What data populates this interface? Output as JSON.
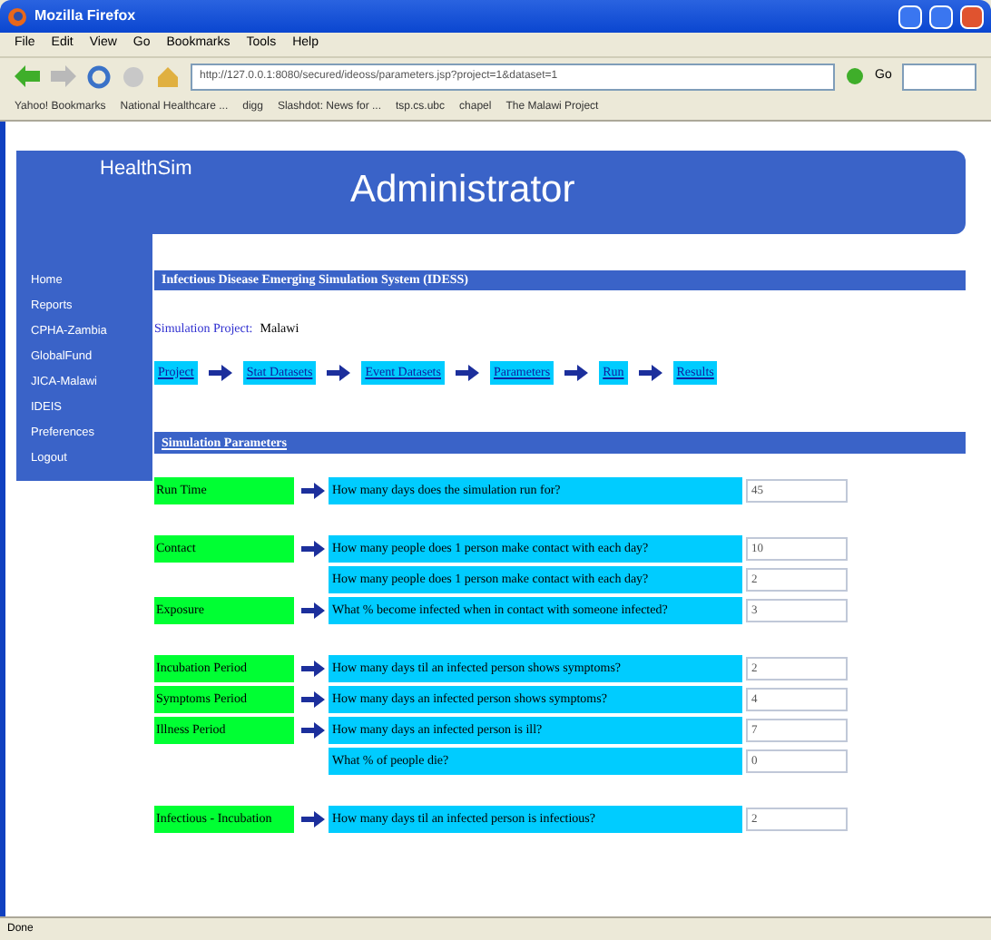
{
  "window": {
    "title": "Mozilla Firefox"
  },
  "menu": [
    "File",
    "Edit",
    "View",
    "Go",
    "Bookmarks",
    "Tools",
    "Help"
  ],
  "address": {
    "value": "http://127.0.0.1:8080/secured/ideoss/parameters.jsp?project=1&dataset=1"
  },
  "go_button": "Go",
  "bookmarks": [
    "Yahoo! Bookmarks",
    "National Healthcare ...",
    "digg",
    "Slashdot: News for ...",
    "tsp.cs.ubc",
    "chapel",
    "The Malawi Project"
  ],
  "header": {
    "logo": "HealthSim",
    "title": "Administrator"
  },
  "sidebar": {
    "items": [
      "Home",
      "Reports",
      "CPHA-Zambia",
      "GlobalFund",
      "JICA-Malawi",
      "IDEIS",
      "Preferences",
      "Logout"
    ]
  },
  "system_title": "Infectious Disease Emerging Simulation System (IDESS)",
  "project": {
    "label": "Simulation Project:",
    "value": "Malawi"
  },
  "steps": [
    "Project",
    "Stat Datasets",
    "Event Datasets",
    "Parameters",
    "Run",
    "Results"
  ],
  "section_title": "Simulation Parameters",
  "groups": [
    {
      "rows": [
        {
          "label": "Run Time",
          "question": "How many days does the simulation run for?",
          "value": "45"
        }
      ]
    },
    {
      "rows": [
        {
          "label": "Contact",
          "question": "How many people does 1 person make contact with each day?",
          "value": "10"
        },
        {
          "question": "How many people does 1 person make contact with each day?",
          "value": "2"
        },
        {
          "label": "Exposure",
          "question": "What % become infected when in contact with someone infected?",
          "value": "3"
        }
      ]
    },
    {
      "rows": [
        {
          "label": "Incubation Period",
          "question": "How many days til an infected person shows symptoms?",
          "value": "2"
        },
        {
          "label": "Symptoms Period",
          "question": "How many days an infected person shows symptoms?",
          "value": "4"
        },
        {
          "label": "Illness Period",
          "question": "How many days an infected person is ill?",
          "value": "7"
        },
        {
          "question": "What % of people die?",
          "value": "0"
        }
      ]
    },
    {
      "rows": [
        {
          "label": "Infectious - Incubation",
          "question": "How many days til an infected person is infectious?",
          "value": "2"
        }
      ]
    }
  ],
  "status_bar": "Done"
}
